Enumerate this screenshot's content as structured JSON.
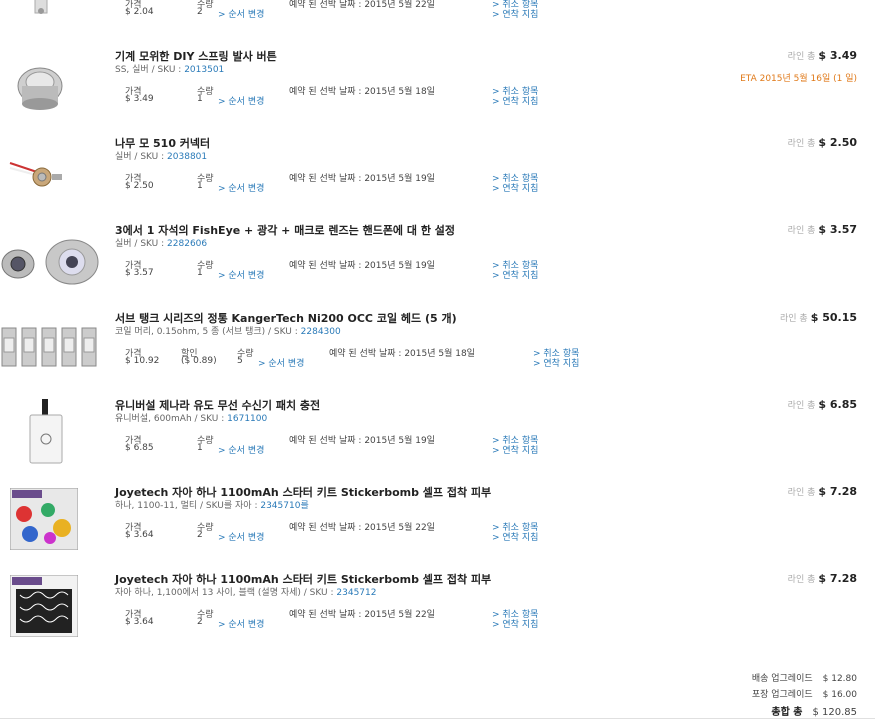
{
  "colors": {
    "link": "#2a7ab8",
    "eta": "#e07a1a",
    "muted": "#aaaaaa"
  },
  "items": [
    {
      "price_label": "가격",
      "price": "$ 2.04",
      "qty_label": "수량",
      "qty": "2",
      "change": "> 순서 변경",
      "delivery_label": "예약 된 선박 날짜 :",
      "delivery": "2015년 5월 22일",
      "cancel": "> 취소 항목",
      "delay": "> 연착 지침"
    },
    {
      "title": "기계 모위한 DIY 스프링 발사 버튼",
      "variant_prefix": "SS, 실버 / SKU :",
      "sku": "2013501",
      "line_total_label": "라인 총",
      "line_total": "$ 3.49",
      "eta": "ETA 2015년 5월 16일 (1 일)",
      "price_label": "가격",
      "price": "$ 3.49",
      "qty_label": "수량",
      "qty": "1",
      "change": "> 순서 변경",
      "delivery_label": "예약 된 선박 날짜 :",
      "delivery": "2015년 5월 18일",
      "cancel": "> 취소 항목",
      "delay": "> 연착 지침"
    },
    {
      "title": "나무 모 510 커넥터",
      "variant_prefix": "실버 / SKU :",
      "sku": "2038801",
      "line_total_label": "라인 총",
      "line_total": "$ 2.50",
      "price_label": "가격",
      "price": "$ 2.50",
      "qty_label": "수량",
      "qty": "1",
      "change": "> 순서 변경",
      "delivery_label": "예약 된 선박 날짜 :",
      "delivery": "2015년 5월 19일",
      "cancel": "> 취소 항목",
      "delay": "> 연착 지침"
    },
    {
      "title": "3에서 1 자석의 FishEye + 광각 + 매크로 렌즈는 핸드폰에 대 한 설정",
      "variant_prefix": "실버 / SKU :",
      "sku": "2282606",
      "line_total_label": "라인 총",
      "line_total": "$ 3.57",
      "price_label": "가격",
      "price": "$ 3.57",
      "qty_label": "수량",
      "qty": "1",
      "change": "> 순서 변경",
      "delivery_label": "예약 된 선박 날짜 :",
      "delivery": "2015년 5월 19일",
      "cancel": "> 취소 항목",
      "delay": "> 연착 지침"
    },
    {
      "title": "서브 탱크 시리즈의 정통 KangerTech Ni200 OCC 코일 헤드 (5 개)",
      "variant_prefix": "코일 머리, 0.15ohm, 5 종 (서브 탱크) / SKU :",
      "sku": "2284300",
      "line_total_label": "라인 총",
      "line_total": "$ 50.15",
      "price_label": "가격",
      "price": "$ 10.92",
      "discount_label": "할인",
      "discount": "($ 0.89)",
      "qty_label": "수량",
      "qty": "5",
      "change": "> 순서 변경",
      "delivery_label": "예약 된 선박 날짜 :",
      "delivery": "2015년 5월 18일",
      "cancel": "> 취소 항목",
      "delay": "> 연착 지침"
    },
    {
      "title": "유니버설 제나라 유도 무선 수신기 패치 충전",
      "variant_prefix": "유니버설, 600mAh / SKU :",
      "sku": "1671100",
      "line_total_label": "라인 총",
      "line_total": "$ 6.85",
      "price_label": "가격",
      "price": "$ 6.85",
      "qty_label": "수량",
      "qty": "1",
      "change": "> 순서 변경",
      "delivery_label": "예약 된 선박 날짜 :",
      "delivery": "2015년 5월 19일",
      "cancel": "> 취소 항목",
      "delay": "> 연착 지침"
    },
    {
      "title": "Joyetech 자아 하나 1100mAh 스타터 키트 Stickerbomb 셀프 접착 피부",
      "variant_prefix": "하나, 1100-11, 멀티 / SKU를 자아 :",
      "sku": "2345710를",
      "line_total_label": "라인 총",
      "line_total": "$ 7.28",
      "price_label": "가격",
      "price": "$ 3.64",
      "qty_label": "수량",
      "qty": "2",
      "change": "> 순서 변경",
      "delivery_label": "예약 된 선박 날짜 :",
      "delivery": "2015년 5월 22일",
      "cancel": "> 취소 항목",
      "delay": "> 연착 지침"
    },
    {
      "title": "Joyetech 자아 하나 1100mAh 스타터 키트 Stickerbomb 셀프 접착 피부",
      "variant_prefix": "자아 하나, 1,100에서 13 사이, 블랙 (설명 자세) / SKU :",
      "sku": "2345712",
      "line_total_label": "라인 총",
      "line_total": "$ 7.28",
      "price_label": "가격",
      "price": "$ 3.64",
      "qty_label": "수량",
      "qty": "2",
      "change": "> 순서 변경",
      "delivery_label": "예약 된 선박 날짜 :",
      "delivery": "2015년 5월 22일",
      "cancel": "> 취소 항목",
      "delay": "> 연착 지침"
    }
  ],
  "summary": {
    "shipping_label": "배송 업그레이드",
    "shipping": "$ 12.80",
    "packaging_label": "포장 업그레이드",
    "packaging": "$ 16.00",
    "total_label": "총합 총",
    "total": "$ 120.85"
  }
}
